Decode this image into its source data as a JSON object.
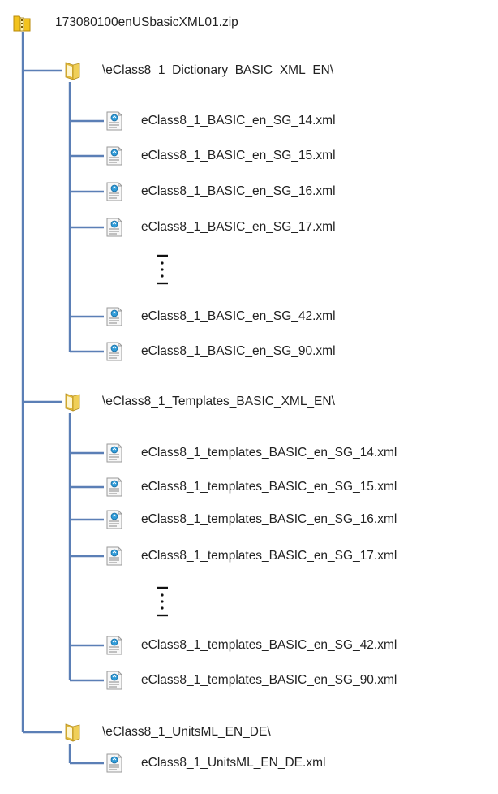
{
  "colors": {
    "connector": "#5b7fb6",
    "zip_yellow": "#f2c31f",
    "folder_yellow": "#f0cf58",
    "text": "#222222"
  },
  "root": {
    "label": "173080100enUSbasicXML01.zip",
    "icon": "zip-folder-icon"
  },
  "folders": [
    {
      "label": "\\eClass8_1_Dictionary_BASIC_XML_EN\\",
      "icon": "folder-icon",
      "files": [
        {
          "label": "eClass8_1_BASIC_en_SG_14.xml",
          "icon": "xml-file-icon"
        },
        {
          "label": "eClass8_1_BASIC_en_SG_15.xml",
          "icon": "xml-file-icon"
        },
        {
          "label": "eClass8_1_BASIC_en_SG_16.xml",
          "icon": "xml-file-icon"
        },
        {
          "label": "eClass8_1_BASIC_en_SG_17.xml",
          "icon": "xml-file-icon"
        },
        {
          "ellipsis": true,
          "icon": "vertical-ellipsis-icon"
        },
        {
          "label": "eClass8_1_BASIC_en_SG_42.xml",
          "icon": "xml-file-icon"
        },
        {
          "label": "eClass8_1_BASIC_en_SG_90.xml",
          "icon": "xml-file-icon"
        }
      ]
    },
    {
      "label": "\\eClass8_1_Templates_BASIC_XML_EN\\",
      "icon": "folder-icon",
      "files": [
        {
          "label": "eClass8_1_templates_BASIC_en_SG_14.xml",
          "icon": "xml-file-icon"
        },
        {
          "label": "eClass8_1_templates_BASIC_en_SG_15.xml",
          "icon": "xml-file-icon"
        },
        {
          "label": "eClass8_1_templates_BASIC_en_SG_16.xml",
          "icon": "xml-file-icon"
        },
        {
          "label": "eClass8_1_templates_BASIC_en_SG_17.xml",
          "icon": "xml-file-icon"
        },
        {
          "ellipsis": true,
          "icon": "vertical-ellipsis-icon"
        },
        {
          "label": "eClass8_1_templates_BASIC_en_SG_42.xml",
          "icon": "xml-file-icon"
        },
        {
          "label": "eClass8_1_templates_BASIC_en_SG_90.xml",
          "icon": "xml-file-icon"
        }
      ]
    },
    {
      "label": "\\eClass8_1_UnitsML_EN_DE\\",
      "icon": "folder-icon",
      "files": [
        {
          "label": "eClass8_1_UnitsML_EN_DE.xml",
          "icon": "xml-file-icon"
        }
      ]
    }
  ]
}
